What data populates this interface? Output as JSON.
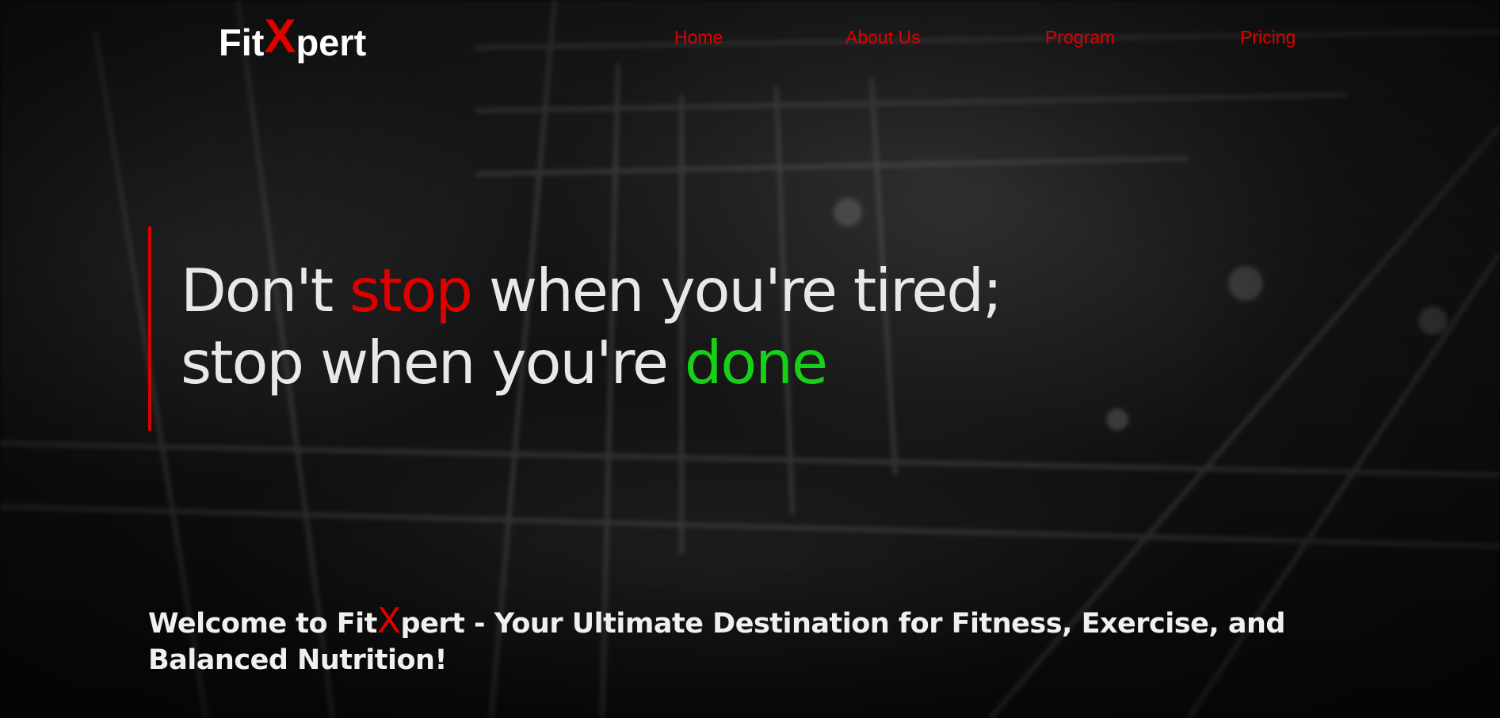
{
  "brand": {
    "prefix": "Fit",
    "accent": "X",
    "suffix": "pert",
    "accent_color": "#e00000"
  },
  "nav": {
    "items": [
      {
        "label": "Home"
      },
      {
        "label": "About Us"
      },
      {
        "label": "Program"
      },
      {
        "label": "Pricing"
      }
    ],
    "link_color": "#e00000"
  },
  "hero": {
    "line1_a": "Don't ",
    "line1_highlight": "stop",
    "line1_b": " when you're tired;",
    "line2_a": "stop when you're ",
    "line2_highlight": "done",
    "stop_color": "#e00000",
    "done_color": "#18d018"
  },
  "welcome": {
    "before": "Welcome to Fit",
    "accent": "X",
    "after": "pert - Your Ultimate Destination for Fitness, Exercise, and Balanced Nutrition!"
  }
}
